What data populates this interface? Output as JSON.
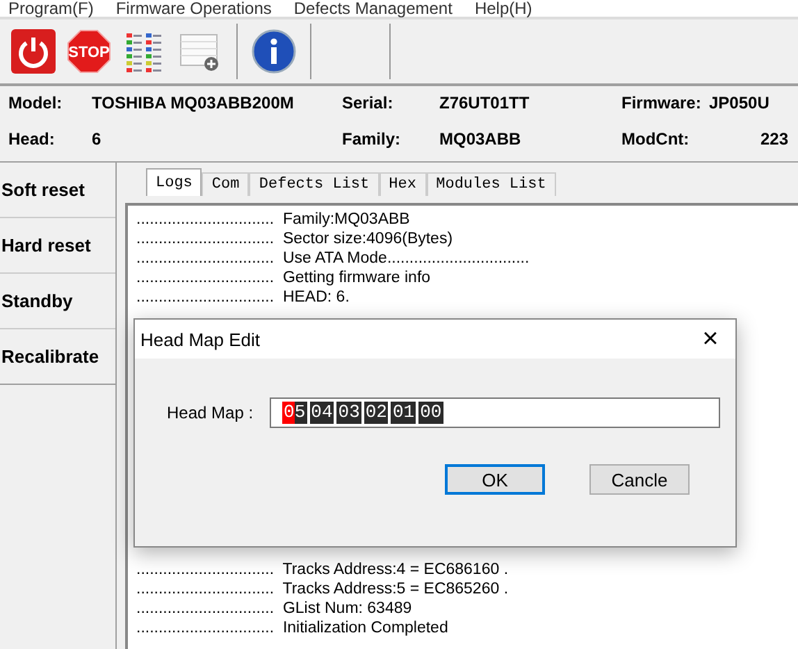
{
  "menu": [
    "Program(F)",
    "Firmware Operations",
    "Defects Management",
    "Help(H)"
  ],
  "toolbar": [
    {
      "kind": "power"
    },
    {
      "kind": "stop",
      "label": "STOP"
    },
    {
      "kind": "list"
    },
    {
      "kind": "table"
    },
    {
      "kind": "info"
    }
  ],
  "info": [
    {
      "label": "Model:",
      "value": "TOSHIBA MQ03ABB200M"
    },
    {
      "label": "Serial:",
      "value": "Z76UT01TT"
    },
    {
      "label": "Firmware:",
      "value": "JP050U"
    },
    {
      "label": "Head:",
      "value": "6"
    },
    {
      "label": "Family:",
      "value": "MQ03ABB"
    },
    {
      "label": "ModCnt:",
      "value": "223"
    }
  ],
  "actions": [
    "Soft reset",
    "Hard reset",
    "Standby",
    "Recalibrate"
  ],
  "tabs": [
    {
      "label": "Logs",
      "selected": true
    },
    {
      "label": "Com",
      "selected": false
    },
    {
      "label": "Defects List",
      "selected": false
    },
    {
      "label": "Hex",
      "selected": false
    },
    {
      "label": "Modules List",
      "selected": false
    }
  ],
  "log_top": [
    {
      "dots": "...............................",
      "text": "Family:MQ03ABB"
    },
    {
      "dots": "...............................",
      "text": "Sector size:4096(Bytes)"
    },
    {
      "dots": "...............................",
      "text": "Use ATA Mode................................"
    },
    {
      "dots": "...............................",
      "text": "Getting firmware info"
    },
    {
      "dots": "...............................",
      "text": "HEAD: 6."
    }
  ],
  "log_bottom": [
    {
      "dots": "...............................",
      "text": "Tracks Address:4 = EC686160 ."
    },
    {
      "dots": "...............................",
      "text": "Tracks Address:5 = EC865260 ."
    },
    {
      "dots": "...............................",
      "text": "GList Num: 63489"
    },
    {
      "dots": "...............................",
      "text": "Initialization Completed"
    }
  ],
  "dialog": {
    "title": "Head Map Edit",
    "close": "×",
    "label": "Head Map :",
    "cells": [
      {
        "value": "05",
        "selected": true
      },
      {
        "value": "04",
        "selected": false
      },
      {
        "value": "03",
        "selected": false
      },
      {
        "value": "02",
        "selected": false
      },
      {
        "value": "01",
        "selected": false
      },
      {
        "value": "00",
        "selected": false
      }
    ],
    "buttons": [
      {
        "label": "OK",
        "default": true
      },
      {
        "label": "Cancle",
        "default": false
      }
    ]
  }
}
